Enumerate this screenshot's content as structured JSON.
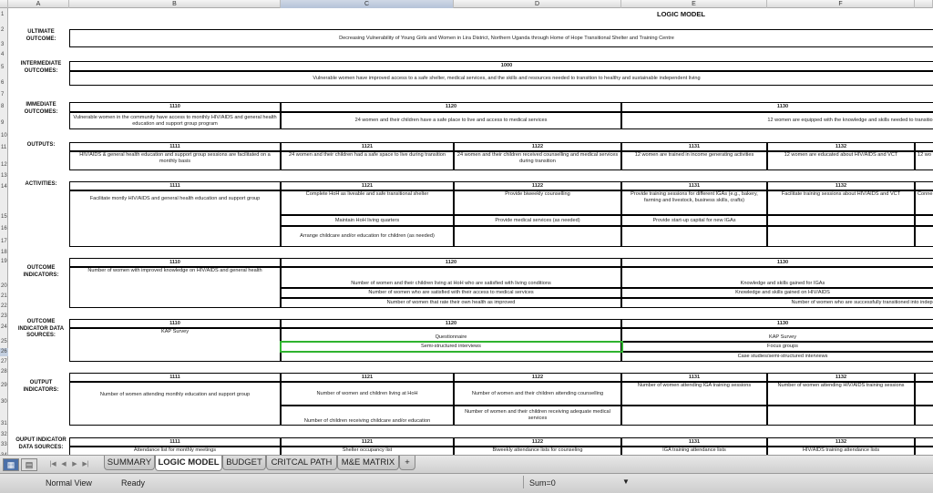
{
  "window": {
    "sheet_title": "LOGIC MODEL"
  },
  "columns": [
    "A",
    "B",
    "C",
    "D",
    "E",
    "F"
  ],
  "selected_column": "C",
  "rows": [
    "1",
    "2",
    "3",
    "4",
    "5",
    "6",
    "7",
    "8",
    "9",
    "10",
    "11",
    "12",
    "13",
    "14",
    "15",
    "16",
    "17",
    "18",
    "19",
    "20",
    "21",
    "22",
    "23",
    "24",
    "25",
    "26",
    "27",
    "28",
    "29",
    "30",
    "31",
    "32",
    "33",
    "34"
  ],
  "selected_row": "26",
  "sections": {
    "ultimate": {
      "label": "ULTIMATE OUTCOME:",
      "text": "Decreasing Vulnerability of Young Girls and Women in Lira District, Northern Uganda through Home of Hope Transitional Shelter and Training Centre"
    },
    "intermediate": {
      "label": "INTERMEDIATE OUTCOMES:",
      "code": "1000",
      "text": "Vulnerable women have improved access to a safe shelter, medical services, and the skills and resources needed to transition to healthy and sustainable independent living"
    },
    "immediate": {
      "label": "IMMEDIATE OUTCOMES:",
      "codes": [
        "1110",
        "1120",
        "1130"
      ],
      "texts": [
        "Vulnerable women in the community have access to monthly HIV/AIDS and general health education and support group program",
        "24 women and their children have a safe place to live and access to medical services",
        "12 women are equipped with the knowledge and skills needed to transition to"
      ]
    },
    "outputs": {
      "label": "OUTPUTS:",
      "codes": [
        "1111",
        "1121",
        "1122",
        "1131",
        "1132"
      ],
      "texts": [
        "HIV/AIDS & general health education and support group sessions are facilitated on a monthly basis",
        "24 women and their children had a safe space to live during transition",
        "24 women and their children received counselling and medical services during transition",
        "12 women are trained in income generating activities",
        "12 women are educated about HIV/AIDS and VCT",
        "12 wo"
      ]
    },
    "activities": {
      "label": "ACTIVITIES:",
      "codes": [
        "1111",
        "1121",
        "1122",
        "1131",
        "1132"
      ],
      "col_b": "Facilitate montly HIV/AIDS and general health education and support group",
      "col_c": [
        "Complete HoH as liveable and safe transitional shelter",
        "Maintain HoH living quarters",
        "Arrange childcare and/or education for children (as needed)"
      ],
      "col_d": [
        "Provide biweekly counselling",
        "Provide medical services (as needed)"
      ],
      "col_e": [
        "Provide training sessions for different IGAs (e.g., bakery, farming and livestock, business skills, crafts)",
        "Provide start-up capital for new IGAs"
      ],
      "col_f": [
        "Facilitate training sessions about HIV/AIDS and VCT"
      ],
      "col_g": [
        "Conne",
        "Cor"
      ]
    },
    "outcome_indicators": {
      "label": "OUTCOME INDICATORS:",
      "codes": [
        "1110",
        "1120",
        "1130"
      ],
      "col_b": "Number of women with improved knowledge on HIV/AIDS and general health",
      "col_cd": [
        "Number of women and their children living at HoH who are satisfied with living conditions",
        "Number of women who are satisfied with their access to medical services",
        "Number of women that rate their own health as improved"
      ],
      "col_ef": [
        "Knowledge and skills gained for IGAs",
        "Knowledge and skills gained on HIV/AIDS",
        "Number of women who are successfully transitioned into independ"
      ]
    },
    "data_sources": {
      "label": "OUTCOME INDICATOR DATA SOURCES:",
      "codes": [
        "1110",
        "1120",
        "1130"
      ],
      "col_b": "KAP Survey",
      "col_cd": [
        "Questionnaire",
        "Semi-structured interviews"
      ],
      "col_ef": [
        "KAP Survey",
        "Focus groups",
        "Case studies/semi-structured interviews"
      ]
    },
    "output_indicators": {
      "label": "OUTPUT INDICATORS:",
      "codes": [
        "1111",
        "1121",
        "1122",
        "1131",
        "1132"
      ],
      "col_b": "Number of women attending monthly education and support group",
      "col_c": [
        "Number of women and children living at HoH",
        "Number of children receiving childcare and/or education"
      ],
      "col_d": [
        "Number of women and their children attending counselling",
        "Number of women and their children receiving adequate medical services"
      ],
      "col_e": "Number of women attending IGA training sessions",
      "col_f": "Number of women attending HIV/AIDS training sessions",
      "col_g": "N"
    },
    "output_sources": {
      "label": "OUPUT INDICATOR DATA SOURCES:",
      "codes": [
        "1111",
        "1121",
        "1122",
        "1131",
        "1132"
      ],
      "texts": [
        "Attendance list for monthly meetings",
        "Shelter occupancy list",
        "Biweekly attendance lists for counseling",
        "IGA training attendance lists",
        "HIV/AIDS training attendance lists"
      ]
    }
  },
  "tabs": {
    "items": [
      "SUMMARY",
      "LOGIC MODEL",
      "BUDGET",
      "CRITCAL PATH",
      "M&E MATRIX"
    ],
    "active": "LOGIC MODEL",
    "add": "+"
  },
  "nav": [
    "|◀",
    "◀",
    "▶",
    "▶|"
  ],
  "status": {
    "view": "Normal View",
    "ready": "Ready",
    "sum": "Sum=0"
  }
}
